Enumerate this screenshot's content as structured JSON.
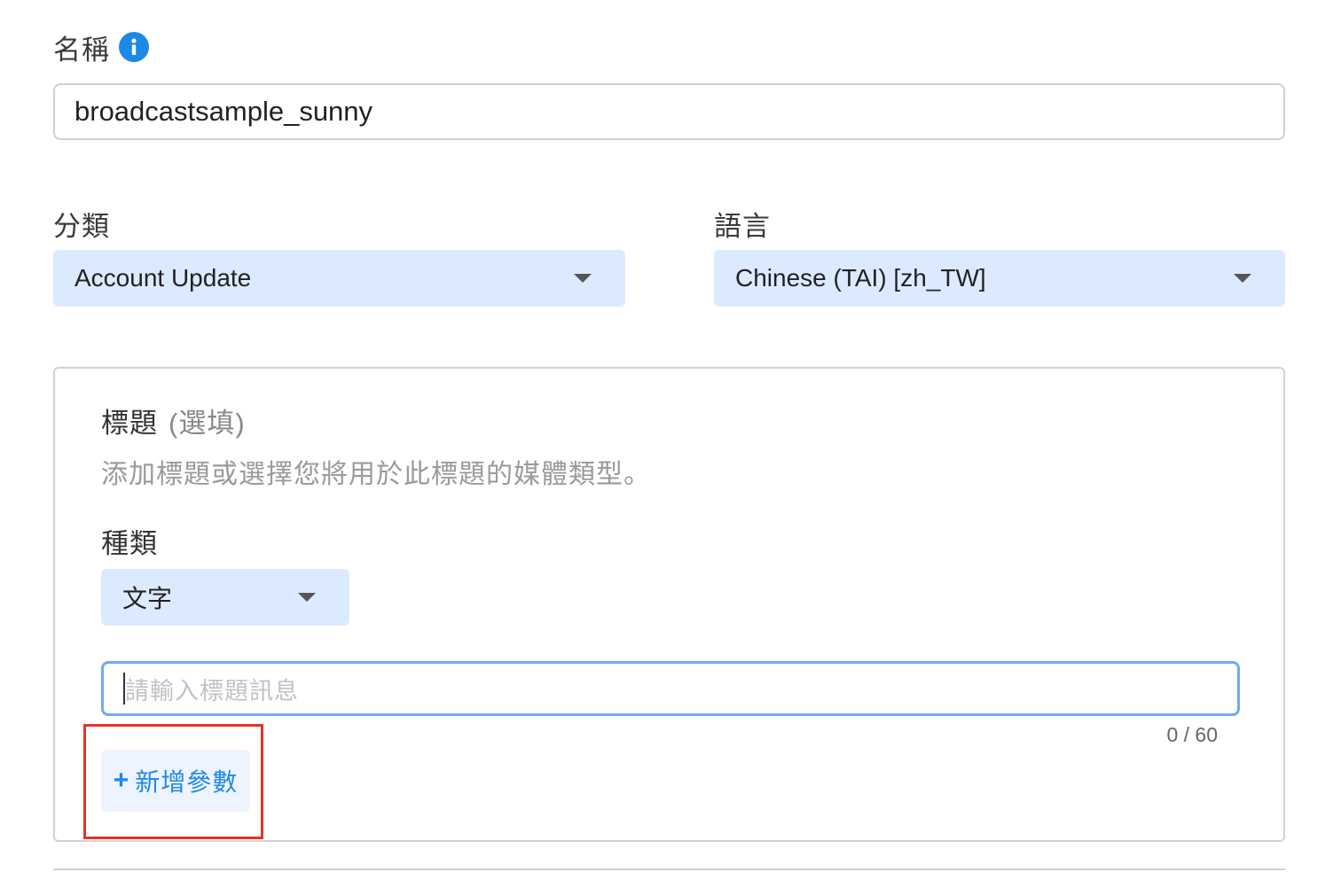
{
  "name_field": {
    "label": "名稱",
    "info_icon": "info-icon",
    "value": "broadcastsample_sunny"
  },
  "category": {
    "label": "分類",
    "selected": "Account Update"
  },
  "language": {
    "label": "語言",
    "selected": "Chinese (TAI) [zh_TW]"
  },
  "header_section": {
    "title": "標題",
    "optional": "(選填)",
    "description": "添加標題或選擇您將用於此標題的媒體類型。",
    "type_label": "種類",
    "type_selected": "文字",
    "input_placeholder": "請輸入標題訊息",
    "char_counter": "0 / 60",
    "add_param_plus": "+",
    "add_param_label": "新增參數"
  },
  "colors": {
    "accent": "#1e88e5",
    "select_bg": "#dceaff",
    "highlight": "#e53322",
    "focus_border": "#73a9f2"
  }
}
